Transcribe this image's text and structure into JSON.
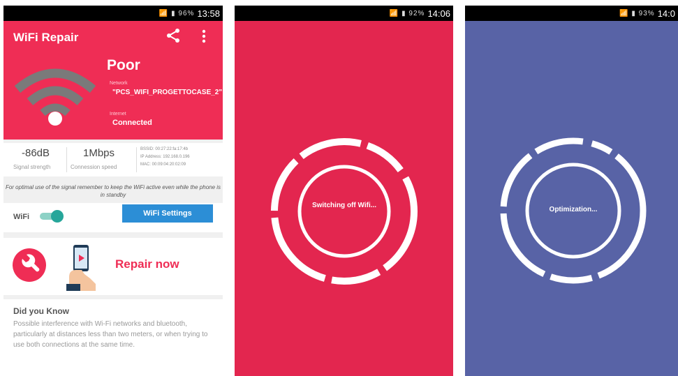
{
  "screen1": {
    "status": {
      "icons": "📶 ▮ 96%",
      "time": "13:58"
    },
    "app_title": "WiFi Repair",
    "quality": "Poor",
    "network_label": "Network",
    "network_name": "\"PCS_WIFI_PROGETTOCASE_2\"",
    "internet_label": "Internet",
    "internet_status": "Connected",
    "signal_value": "-86dB",
    "signal_label": "Signal strength",
    "speed_value": "1Mbps",
    "speed_label": "Connession speed",
    "bssid": "BSSID: 00:27:22:fa:17:4b",
    "ip": "IP Address: 192.168.0.196",
    "mac": "MAC: 00:09:04:20:02:09",
    "hint": "For optimal use of the signal remember to keep the WiFi active even while the phone is in standby",
    "wifi_label": "WiFi",
    "wifi_on": true,
    "wifi_settings_label": "WiFi Settings",
    "repair_label": "Repair now",
    "know_title": "Did you Know",
    "know_body": "Possible interference with Wi-Fi networks and bluetooth, particularly at distances less than two meters, or when trying to use both connections at the same time."
  },
  "screen2": {
    "status": {
      "icons": "📶 ▮ 92%",
      "time": "14:06"
    },
    "message": "Switching off Wifi...",
    "background": "#e3264f"
  },
  "screen3": {
    "status": {
      "icons": "📶 ▮ 93%",
      "time": "14:0"
    },
    "message": "Optimization...",
    "background": "#5863a6"
  },
  "colors": {
    "accent": "#ef2d55",
    "button": "#2c8ed6",
    "toggle": "#26a69a"
  }
}
